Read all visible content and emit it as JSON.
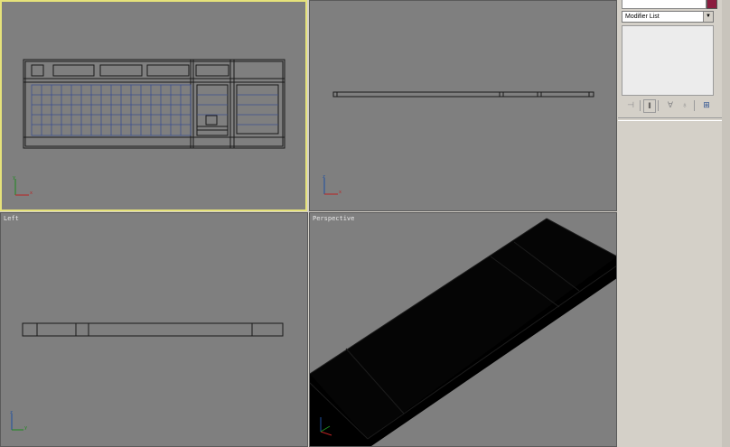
{
  "viewports": {
    "top": {
      "label": ""
    },
    "front": {
      "label": ""
    },
    "left": {
      "label": "Left"
    },
    "perspective": {
      "label": "Perspective"
    }
  },
  "axis": {
    "x": "x",
    "y": "y",
    "z": "z"
  },
  "command_panel": {
    "modifier_list": "Modifier List",
    "dropdown_arrow": "▼",
    "tools": {
      "pin_stack": "⊣",
      "show_end_result": "‖",
      "make_unique": "∀",
      "remove_modifier": "♁",
      "configure_sets": "⊞"
    }
  },
  "colors": {
    "viewport_bg": "#7f7f7f",
    "active_border": "#e6e27a",
    "object_color": "#8b1c3f"
  }
}
